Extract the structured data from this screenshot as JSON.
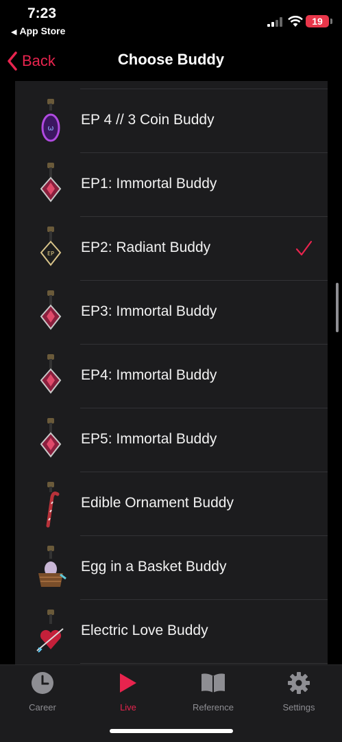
{
  "status_bar": {
    "time": "7:23",
    "back_app": "App Store",
    "battery": "19"
  },
  "nav": {
    "back_label": "Back",
    "title": "Choose Buddy"
  },
  "list": {
    "items": [
      {
        "label": "EP 4 // 3 Coin Buddy",
        "selected": false,
        "icon": "coin-buddy-icon"
      },
      {
        "label": "EP1: Immortal Buddy",
        "selected": false,
        "icon": "immortal-buddy-icon"
      },
      {
        "label": "EP2: Radiant Buddy",
        "selected": true,
        "icon": "radiant-buddy-icon"
      },
      {
        "label": "EP3: Immortal Buddy",
        "selected": false,
        "icon": "immortal-buddy-icon"
      },
      {
        "label": "EP4: Immortal Buddy",
        "selected": false,
        "icon": "immortal-buddy-icon"
      },
      {
        "label": "EP5: Immortal Buddy",
        "selected": false,
        "icon": "immortal-buddy-icon"
      },
      {
        "label": "Edible Ornament Buddy",
        "selected": false,
        "icon": "candy-cane-buddy-icon"
      },
      {
        "label": "Egg in a Basket Buddy",
        "selected": false,
        "icon": "egg-basket-buddy-icon"
      },
      {
        "label": "Electric Love Buddy",
        "selected": false,
        "icon": "heart-buddy-icon"
      }
    ]
  },
  "tabs": [
    {
      "label": "Career",
      "icon": "clock-icon",
      "active": false
    },
    {
      "label": "Live",
      "icon": "play-icon",
      "active": true
    },
    {
      "label": "Reference",
      "icon": "book-icon",
      "active": false
    },
    {
      "label": "Settings",
      "icon": "gear-icon",
      "active": false
    }
  ],
  "colors": {
    "accent": "#e8244e",
    "background": "#000000",
    "list_background": "#1c1c1e",
    "battery": "#e8364a"
  }
}
